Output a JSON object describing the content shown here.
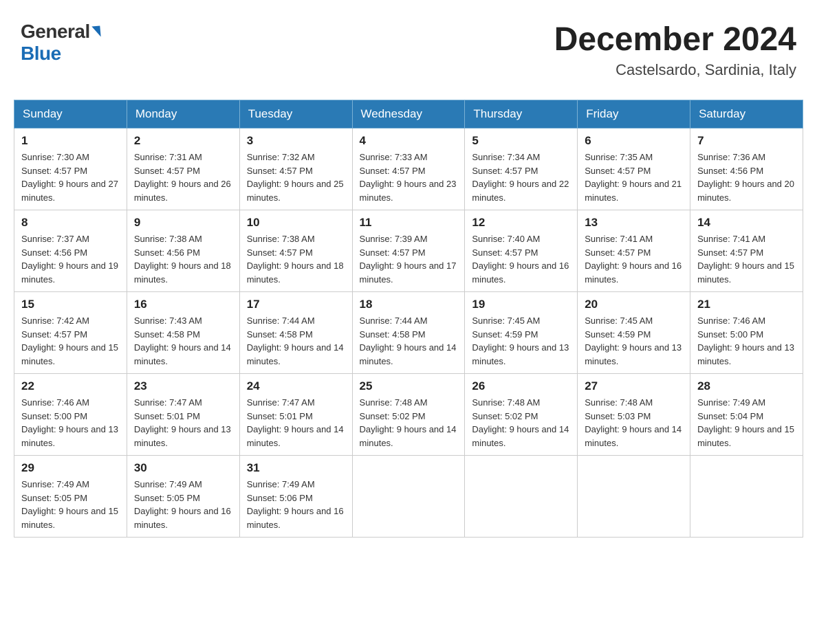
{
  "logo": {
    "general": "General",
    "blue": "Blue",
    "arrow": "▶"
  },
  "header": {
    "month_title": "December 2024",
    "location": "Castelsardo, Sardinia, Italy"
  },
  "weekdays": [
    "Sunday",
    "Monday",
    "Tuesday",
    "Wednesday",
    "Thursday",
    "Friday",
    "Saturday"
  ],
  "weeks": [
    [
      {
        "day": "1",
        "sunrise": "7:30 AM",
        "sunset": "4:57 PM",
        "daylight": "9 hours and 27 minutes."
      },
      {
        "day": "2",
        "sunrise": "7:31 AM",
        "sunset": "4:57 PM",
        "daylight": "9 hours and 26 minutes."
      },
      {
        "day": "3",
        "sunrise": "7:32 AM",
        "sunset": "4:57 PM",
        "daylight": "9 hours and 25 minutes."
      },
      {
        "day": "4",
        "sunrise": "7:33 AM",
        "sunset": "4:57 PM",
        "daylight": "9 hours and 23 minutes."
      },
      {
        "day": "5",
        "sunrise": "7:34 AM",
        "sunset": "4:57 PM",
        "daylight": "9 hours and 22 minutes."
      },
      {
        "day": "6",
        "sunrise": "7:35 AM",
        "sunset": "4:57 PM",
        "daylight": "9 hours and 21 minutes."
      },
      {
        "day": "7",
        "sunrise": "7:36 AM",
        "sunset": "4:56 PM",
        "daylight": "9 hours and 20 minutes."
      }
    ],
    [
      {
        "day": "8",
        "sunrise": "7:37 AM",
        "sunset": "4:56 PM",
        "daylight": "9 hours and 19 minutes."
      },
      {
        "day": "9",
        "sunrise": "7:38 AM",
        "sunset": "4:56 PM",
        "daylight": "9 hours and 18 minutes."
      },
      {
        "day": "10",
        "sunrise": "7:38 AM",
        "sunset": "4:57 PM",
        "daylight": "9 hours and 18 minutes."
      },
      {
        "day": "11",
        "sunrise": "7:39 AM",
        "sunset": "4:57 PM",
        "daylight": "9 hours and 17 minutes."
      },
      {
        "day": "12",
        "sunrise": "7:40 AM",
        "sunset": "4:57 PM",
        "daylight": "9 hours and 16 minutes."
      },
      {
        "day": "13",
        "sunrise": "7:41 AM",
        "sunset": "4:57 PM",
        "daylight": "9 hours and 16 minutes."
      },
      {
        "day": "14",
        "sunrise": "7:41 AM",
        "sunset": "4:57 PM",
        "daylight": "9 hours and 15 minutes."
      }
    ],
    [
      {
        "day": "15",
        "sunrise": "7:42 AM",
        "sunset": "4:57 PM",
        "daylight": "9 hours and 15 minutes."
      },
      {
        "day": "16",
        "sunrise": "7:43 AM",
        "sunset": "4:58 PM",
        "daylight": "9 hours and 14 minutes."
      },
      {
        "day": "17",
        "sunrise": "7:44 AM",
        "sunset": "4:58 PM",
        "daylight": "9 hours and 14 minutes."
      },
      {
        "day": "18",
        "sunrise": "7:44 AM",
        "sunset": "4:58 PM",
        "daylight": "9 hours and 14 minutes."
      },
      {
        "day": "19",
        "sunrise": "7:45 AM",
        "sunset": "4:59 PM",
        "daylight": "9 hours and 13 minutes."
      },
      {
        "day": "20",
        "sunrise": "7:45 AM",
        "sunset": "4:59 PM",
        "daylight": "9 hours and 13 minutes."
      },
      {
        "day": "21",
        "sunrise": "7:46 AM",
        "sunset": "5:00 PM",
        "daylight": "9 hours and 13 minutes."
      }
    ],
    [
      {
        "day": "22",
        "sunrise": "7:46 AM",
        "sunset": "5:00 PM",
        "daylight": "9 hours and 13 minutes."
      },
      {
        "day": "23",
        "sunrise": "7:47 AM",
        "sunset": "5:01 PM",
        "daylight": "9 hours and 13 minutes."
      },
      {
        "day": "24",
        "sunrise": "7:47 AM",
        "sunset": "5:01 PM",
        "daylight": "9 hours and 14 minutes."
      },
      {
        "day": "25",
        "sunrise": "7:48 AM",
        "sunset": "5:02 PM",
        "daylight": "9 hours and 14 minutes."
      },
      {
        "day": "26",
        "sunrise": "7:48 AM",
        "sunset": "5:02 PM",
        "daylight": "9 hours and 14 minutes."
      },
      {
        "day": "27",
        "sunrise": "7:48 AM",
        "sunset": "5:03 PM",
        "daylight": "9 hours and 14 minutes."
      },
      {
        "day": "28",
        "sunrise": "7:49 AM",
        "sunset": "5:04 PM",
        "daylight": "9 hours and 15 minutes."
      }
    ],
    [
      {
        "day": "29",
        "sunrise": "7:49 AM",
        "sunset": "5:05 PM",
        "daylight": "9 hours and 15 minutes."
      },
      {
        "day": "30",
        "sunrise": "7:49 AM",
        "sunset": "5:05 PM",
        "daylight": "9 hours and 16 minutes."
      },
      {
        "day": "31",
        "sunrise": "7:49 AM",
        "sunset": "5:06 PM",
        "daylight": "9 hours and 16 minutes."
      },
      null,
      null,
      null,
      null
    ]
  ]
}
